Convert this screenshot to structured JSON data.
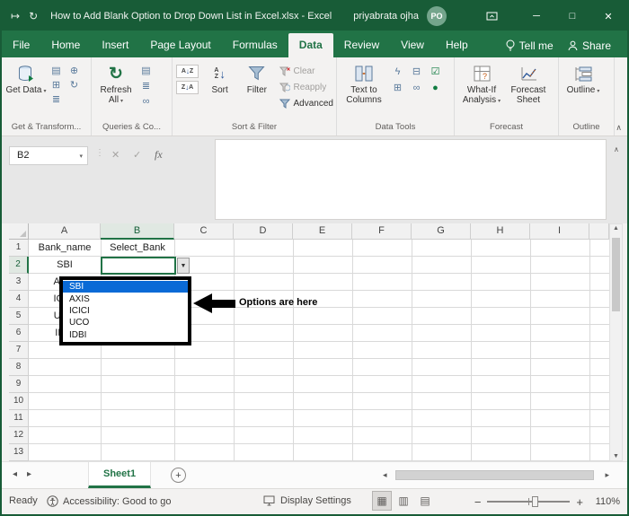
{
  "colors": {
    "title_bar_green": "#185C37",
    "ribbon_green": "#217346",
    "selection_green": "#217346",
    "dropdown_highlight_blue": "#0A6AD6",
    "annotation_black": "#000000"
  },
  "title_bar": {
    "title": "How to Add Blank Option to Drop Down List in Excel.xlsx  -  Excel",
    "user_name": "priyabrata ojha",
    "avatar_initials": "PO"
  },
  "ribbon": {
    "tabs": [
      "File",
      "Home",
      "Insert",
      "Page Layout",
      "Formulas",
      "Data",
      "Review",
      "View",
      "Help"
    ],
    "active_tab": "Data",
    "tell_me_label": "Tell me",
    "share_label": "Share",
    "group_labels": [
      "Get & Transform...",
      "Queries & Co...",
      "Sort & Filter",
      "Data Tools",
      "Forecast",
      "Outline"
    ],
    "buttons": {
      "get_data": "Get Data",
      "refresh_all": "Refresh All",
      "sort": "Sort",
      "filter": "Filter",
      "clear": "Clear",
      "reapply": "Reapply",
      "advanced": "Advanced",
      "text_to_columns": "Text to Columns",
      "what_if_analysis": "What-If Analysis",
      "forecast_sheet": "Forecast Sheet",
      "outline": "Outline"
    }
  },
  "formula_bar": {
    "name_box": "B2",
    "fx": "fx"
  },
  "sheet": {
    "columns": [
      "A",
      "B",
      "C",
      "D",
      "E",
      "F",
      "G",
      "H",
      "I"
    ],
    "rows": [
      "1",
      "2",
      "3",
      "4",
      "5",
      "6",
      "7",
      "8",
      "9",
      "10",
      "11",
      "12",
      "13"
    ],
    "cells": {
      "A1": "Bank_name",
      "B1": "Select_Bank",
      "A2": "SBI",
      "A3": "AXIS",
      "A4": "ICICI",
      "A5": "UCO",
      "A6": "IDBI"
    },
    "selected_cell": "B2"
  },
  "dropdown": {
    "items": [
      "SBI",
      "AXIS",
      "ICICI",
      "UCO",
      "IDBI"
    ],
    "highlighted": "SBI"
  },
  "annotation": {
    "label": "Options are here"
  },
  "sheet_tabs": {
    "active": "Sheet1"
  },
  "status_bar": {
    "mode": "Ready",
    "accessibility": "Accessibility: Good to go",
    "display_settings": "Display Settings",
    "zoom": "110%"
  }
}
